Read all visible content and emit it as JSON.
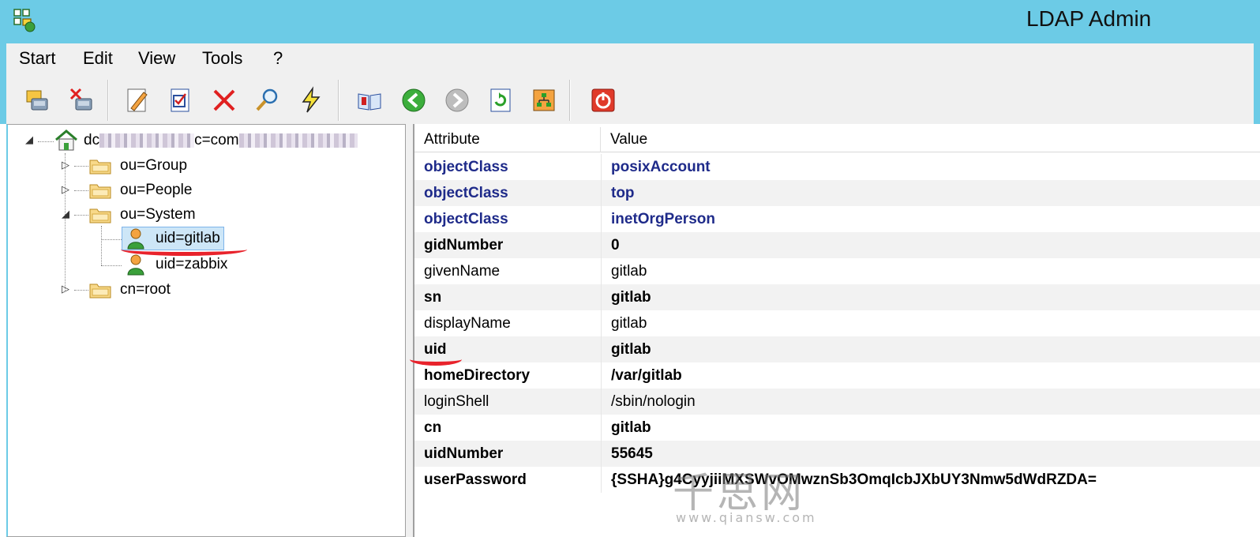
{
  "window": {
    "title": "LDAP Admin"
  },
  "menu": {
    "items": [
      "Start",
      "Edit",
      "View",
      "Tools",
      "?"
    ]
  },
  "toolbar": {
    "buttons": [
      {
        "name": "connect-icon"
      },
      {
        "name": "disconnect-icon"
      },
      {
        "name": "edit-entry-icon"
      },
      {
        "name": "properties-icon"
      },
      {
        "name": "delete-icon"
      },
      {
        "name": "search-icon"
      },
      {
        "name": "lightning-icon"
      },
      {
        "name": "schema-book-icon"
      },
      {
        "name": "back-icon"
      },
      {
        "name": "forward-icon"
      },
      {
        "name": "refresh-icon"
      },
      {
        "name": "org-tree-icon"
      },
      {
        "name": "exit-icon"
      }
    ]
  },
  "tree": {
    "root": {
      "prefix": "dc",
      "mid": "c=com"
    },
    "nodes": [
      {
        "label": "ou=Group"
      },
      {
        "label": "ou=People"
      },
      {
        "label": "ou=System"
      },
      {
        "label": "uid=gitlab"
      },
      {
        "label": "uid=zabbix"
      },
      {
        "label": "cn=root"
      }
    ]
  },
  "attributes": {
    "columns": {
      "attribute": "Attribute",
      "value": "Value"
    },
    "rows": [
      {
        "attribute": "objectClass",
        "value": "posixAccount"
      },
      {
        "attribute": "objectClass",
        "value": "top"
      },
      {
        "attribute": "objectClass",
        "value": "inetOrgPerson"
      },
      {
        "attribute": "gidNumber",
        "value": "0"
      },
      {
        "attribute": "givenName",
        "value": "gitlab"
      },
      {
        "attribute": "sn",
        "value": "gitlab"
      },
      {
        "attribute": "displayName",
        "value": "gitlab"
      },
      {
        "attribute": "uid",
        "value": "gitlab"
      },
      {
        "attribute": "homeDirectory",
        "value": "/var/gitlab"
      },
      {
        "attribute": "loginShell",
        "value": "/sbin/nologin"
      },
      {
        "attribute": "cn",
        "value": "gitlab"
      },
      {
        "attribute": "uidNumber",
        "value": "55645"
      },
      {
        "attribute": "userPassword",
        "value": "{SSHA}g4CyyjiiMXSWvOMwznSb3OmqIcbJXbUY3Nmw5dWdRZDA="
      }
    ]
  },
  "watermark": {
    "main": "千思网",
    "url": "www.qiansw.com"
  }
}
